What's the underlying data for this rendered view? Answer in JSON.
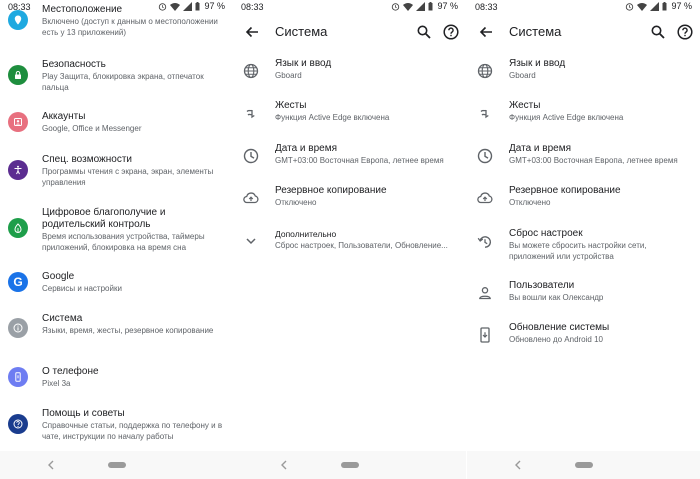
{
  "status": {
    "time": "08:33",
    "battery": "97 %"
  },
  "left_list": {
    "items": [
      {
        "title": "Местоположение",
        "subtitle": "Включено (доступ к данным о местоположении есть у 13 приложений)",
        "icon": "location-icon",
        "color": "#1fa9e0"
      },
      {
        "title": "Безопасность",
        "subtitle": "Play Защита, блокировка экрана, отпечаток пальца",
        "icon": "lock-icon",
        "color": "#1e8e3e"
      },
      {
        "title": "Аккаунты",
        "subtitle": "Google, Office и Messenger",
        "icon": "account-icon",
        "color": "#e8707f"
      },
      {
        "title": "Спец. возможности",
        "subtitle": "Программы чтения с экрана, экран, элементы управления",
        "icon": "accessibility-icon",
        "color": "#5c2d91"
      },
      {
        "title": "Цифровое благополучие и родительский контроль",
        "subtitle": "Время использования устройства, таймеры приложений, блокировка на время сна",
        "icon": "wellbeing-icon",
        "color": "#1e9e4a"
      },
      {
        "title": "Google",
        "subtitle": "Сервисы и настройки",
        "icon": "google-icon",
        "color": "#1a73e8"
      },
      {
        "title": "Система",
        "subtitle": "Языки, время, жесты, резервное копирование",
        "icon": "info-icon",
        "color": "#9aa0a6"
      },
      {
        "title": "О телефоне",
        "subtitle": "Pixel 3a",
        "icon": "phone-icon",
        "color": "#6e7df2"
      },
      {
        "title": "Помощь и советы",
        "subtitle": "Справочные статьи, поддержка по телефону и в чате, инструкции по началу работы",
        "icon": "help-icon",
        "color": "#1a3c8e"
      }
    ]
  },
  "system_collapsed": {
    "title": "Система",
    "items": [
      {
        "title": "Язык и ввод",
        "subtitle": "Gboard",
        "icon": "globe-icon"
      },
      {
        "title": "Жесты",
        "subtitle": "Функция Active Edge включена",
        "icon": "gesture-icon"
      },
      {
        "title": "Дата и время",
        "subtitle": "GMT+03:00 Восточная Европа, летнее время",
        "icon": "clock-icon"
      },
      {
        "title": "Резервное копирование",
        "subtitle": "Отключено",
        "icon": "backup-icon"
      },
      {
        "title": "Дополнительно",
        "subtitle": "Сброс настроек, Пользователи, Обновление...",
        "icon": "chevron-down-icon"
      }
    ]
  },
  "system_expanded": {
    "title": "Система",
    "items": [
      {
        "title": "Язык и ввод",
        "subtitle": "Gboard",
        "icon": "globe-icon"
      },
      {
        "title": "Жесты",
        "subtitle": "Функция Active Edge включена",
        "icon": "gesture-icon"
      },
      {
        "title": "Дата и время",
        "subtitle": "GMT+03:00 Восточная Европа, летнее время",
        "icon": "clock-icon"
      },
      {
        "title": "Резервное копирование",
        "subtitle": "Отключено",
        "icon": "backup-icon"
      },
      {
        "title": "Сброс настроек",
        "subtitle": "Вы можете сбросить настройки сети, приложений или устройства",
        "icon": "reset-icon"
      },
      {
        "title": "Пользователи",
        "subtitle": "Вы вошли как Олександр",
        "icon": "person-icon"
      },
      {
        "title": "Обновление системы",
        "subtitle": "Обновлено до Android 10",
        "icon": "system-update-icon"
      }
    ]
  }
}
